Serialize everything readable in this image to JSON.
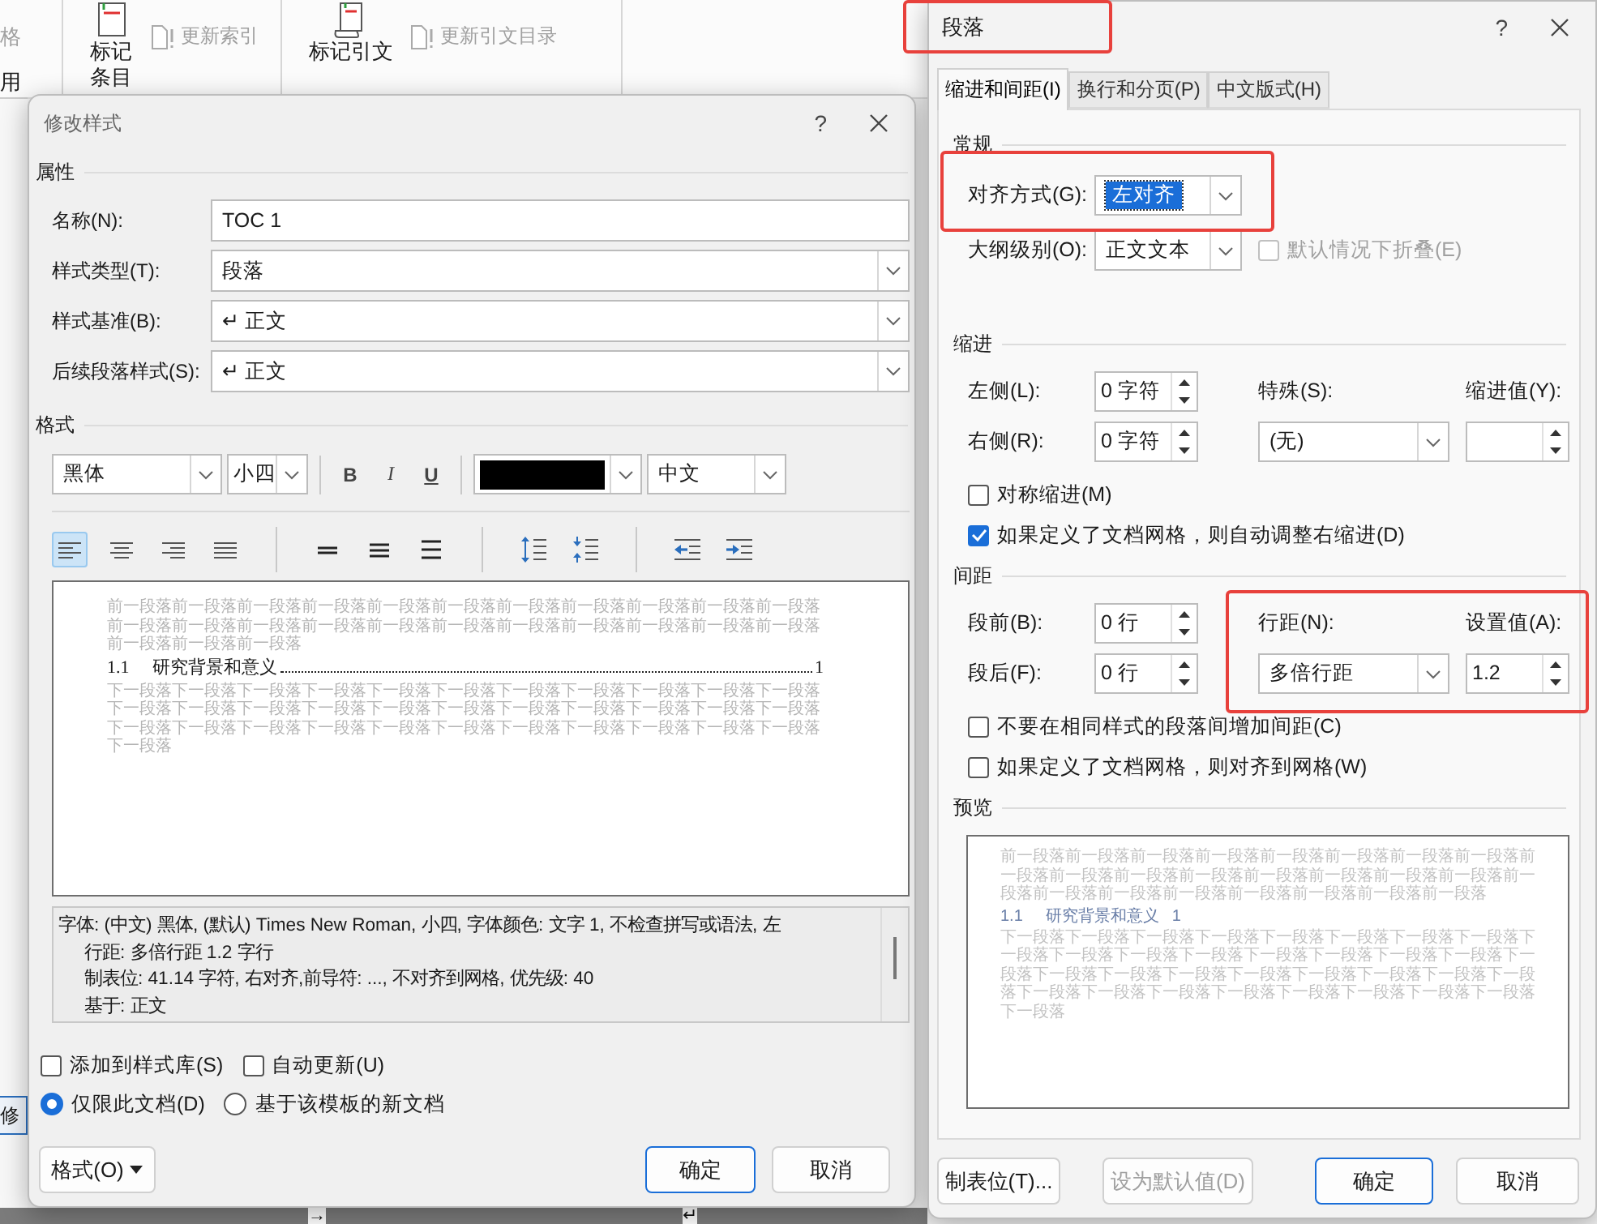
{
  "ribbon": {
    "side_labels": [
      {
        "label": "格",
        "disabled": true
      },
      {
        "label": "用",
        "disabled": false
      }
    ],
    "groups": [
      {
        "button": "标记条目",
        "small_button": {
          "label": "更新索引",
          "disabled": true
        }
      },
      {
        "button": "标记引文",
        "small_button": {
          "label": "更新引文目录",
          "disabled": true
        }
      }
    ]
  },
  "background": {
    "side_tab": "修",
    "marks": [
      "→",
      "↵"
    ]
  },
  "modify_style": {
    "title": "修改样式",
    "help": "?",
    "properties_heading": "属性",
    "fields": [
      {
        "label": "名称(N):",
        "value": "TOC 1",
        "kind": "text"
      },
      {
        "label": "样式类型(T):",
        "value": "段落",
        "kind": "dropdown"
      },
      {
        "label": "样式基准(B):",
        "value": "↵ 正文",
        "kind": "dropdown"
      },
      {
        "label": "后续段落样式(S):",
        "value": "↵ 正文",
        "kind": "dropdown"
      }
    ],
    "format_heading": "格式",
    "font": "黑体",
    "size": "小四",
    "style_buttons": [
      {
        "label": "B",
        "kind": "bold",
        "selected": false
      },
      {
        "label": "I",
        "kind": "italic",
        "selected": false
      },
      {
        "label": "U",
        "kind": "underline",
        "selected": false
      }
    ],
    "language": "中文",
    "paragraph_tools": [
      {
        "kind": "align-left",
        "selected": true
      },
      {
        "kind": "align-center",
        "selected": false
      },
      {
        "kind": "align-right",
        "selected": false
      },
      {
        "kind": "justify",
        "selected": false
      },
      {
        "kind": "single-spacing",
        "selected": false
      },
      {
        "kind": "one-half-spacing",
        "selected": false
      },
      {
        "kind": "double-spacing",
        "selected": false
      },
      {
        "kind": "increase-spacing",
        "selected": false
      },
      {
        "kind": "decrease-spacing",
        "selected": false
      },
      {
        "kind": "decrease-indent",
        "selected": false
      },
      {
        "kind": "increase-indent",
        "selected": false
      }
    ],
    "preview": {
      "previous": "前一段落前一段落前一段落前一段落前一段落前一段落前一段落前一段落前一段落前一段落前一段落前一段落前一段落前一段落前一段落前一段落前一段落前一段落前一段落前一段落前一段落前一段落前一段落前一段落前一段落",
      "entry_number": "1.1",
      "entry_title": "研究背景和意义",
      "entry_page": "1",
      "next": "下一段落下一段落下一段落下一段落下一段落下一段落下一段落下一段落下一段落下一段落下一段落下一段落下一段落下一段落下一段落下一段落下一段落下一段落下一段落下一段落下一段落下一段落下一段落下一段落下一段落下一段落下一段落下一段落下一段落下一段落下一段落下一段落下一段落下一段落"
    },
    "description": [
      "字体: (中文) 黑体, (默认) Times New Roman, 小四, 字体颜色: 文字 1, 不检查拼写或语法, 左",
      "行距: 多倍行距 1.2 字行",
      "制表位:  41.14 字符, 右对齐,前导符: ..., 不对齐到网格, 优先级: 40",
      "基于: 正文"
    ],
    "checkboxes": [
      {
        "label": "添加到样式库(S)",
        "checked": false
      },
      {
        "label": "自动更新(U)",
        "checked": false
      }
    ],
    "radios": [
      {
        "label": "仅限此文档(D)",
        "selected": true
      },
      {
        "label": "基于该模板的新文档",
        "selected": false
      }
    ],
    "buttons": [
      {
        "label": "格式(O)",
        "kind": "menu"
      },
      {
        "label": "确定",
        "kind": "default"
      },
      {
        "label": "取消",
        "kind": "normal"
      }
    ]
  },
  "paragraph": {
    "title": "段落",
    "help": "?",
    "tabs": [
      {
        "label": "缩进和间距(I)",
        "selected": true
      },
      {
        "label": "换行和分页(P)",
        "selected": false
      },
      {
        "label": "中文版式(H)",
        "selected": false
      }
    ],
    "general": {
      "heading": "常规",
      "alignment": {
        "label": "对齐方式(G):",
        "value": "左对齐",
        "highlighted": true
      },
      "outline_level": {
        "label": "大纲级别(O):",
        "value": "正文文本"
      },
      "collapse": {
        "label": "默认情况下折叠(E)",
        "checked": false,
        "disabled": true
      }
    },
    "indent": {
      "heading": "缩进",
      "left": {
        "label": "左侧(L):",
        "value": "0 字符"
      },
      "right": {
        "label": "右侧(R):",
        "value": "0 字符"
      },
      "special": {
        "label": "特殊(S):",
        "value": "(无)"
      },
      "by": {
        "label": "缩进值(Y):"
      },
      "checkboxes": [
        {
          "label": "对称缩进(M)",
          "checked": false
        },
        {
          "label": "如果定义了文档网格，则自动调整右缩进(D)",
          "checked": true
        }
      ]
    },
    "spacing": {
      "heading": "间距",
      "before": {
        "label": "段前(B):",
        "value": "0 行"
      },
      "after": {
        "label": "段后(F):",
        "value": "0 行"
      },
      "line_spacing": {
        "label": "行距(N):",
        "value": "多倍行距"
      },
      "at": {
        "label": "设置值(A):",
        "value": "1.2"
      },
      "checkboxes": [
        {
          "label": "不要在相同样式的段落间增加间距(C)",
          "checked": false
        },
        {
          "label": "如果定义了文档网格，则对齐到网格(W)",
          "checked": false
        }
      ]
    },
    "preview": {
      "heading": "预览",
      "previous": "前一段落前一段落前一段落前一段落前一段落前一段落前一段落前一段落前一段落前一段落前一段落前一段落前一段落前一段落前一段落前一段落前一段落前一段落前一段落前一段落前一段落前一段落前一段落前一段落",
      "entry_number": "1.1",
      "entry_title": "研究背景和意义",
      "entry_page": "1",
      "next": "下一段落下一段落下一段落下一段落下一段落下一段落下一段落下一段落下一段落下一段落下一段落下一段落下一段落下一段落下一段落下一段落下一段落下一段落下一段落下一段落下一段落下一段落下一段落下一段落下一段落下一段落下一段落下一段落下一段落下一段落下一段落下一段落下一段落下一段落"
    },
    "buttons": [
      {
        "label": "制表位(T)...",
        "kind": "normal",
        "disabled": false
      },
      {
        "label": "设为默认值(D)",
        "kind": "normal",
        "disabled": true
      },
      {
        "label": "确定",
        "kind": "default",
        "disabled": false
      },
      {
        "label": "取消",
        "kind": "normal",
        "disabled": false
      }
    ]
  }
}
